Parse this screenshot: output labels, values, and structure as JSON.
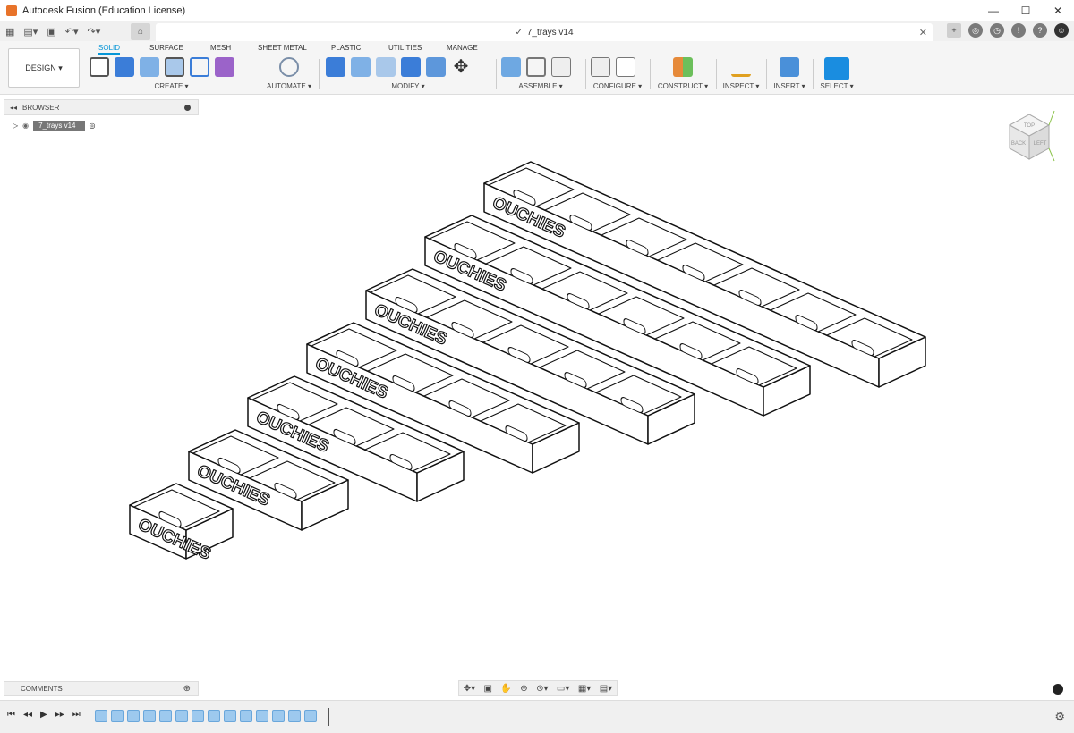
{
  "window": {
    "title": "Autodesk Fusion (Education License)",
    "minimize": "—",
    "maximize": "☐",
    "close": "✕"
  },
  "tab": {
    "name": "7_trays v14",
    "check": "✓",
    "close": "✕"
  },
  "ribbon": {
    "tabs": [
      "SOLID",
      "SURFACE",
      "MESH",
      "SHEET METAL",
      "PLASTIC",
      "UTILITIES",
      "MANAGE"
    ],
    "design_label": "DESIGN ▾",
    "groups": [
      "CREATE ▾",
      "AUTOMATE ▾",
      "MODIFY ▾",
      "ASSEMBLE ▾",
      "CONFIGURE ▾",
      "CONSTRUCT ▾",
      "INSPECT ▾",
      "INSERT ▾",
      "SELECT ▾"
    ]
  },
  "browser": {
    "label": "BROWSER",
    "component": "7_trays v14"
  },
  "comments": {
    "label": "COMMENTS"
  },
  "model": {
    "label": "OUCHIES"
  },
  "viewcube": {
    "front": "BACK",
    "right": "LEFT",
    "top": "TOP"
  },
  "colors": {
    "accent": "#0696d7",
    "toolbar_bg": "#f5f5f5"
  }
}
